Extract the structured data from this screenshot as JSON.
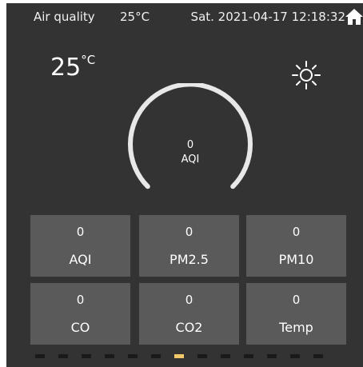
{
  "status_bar": {
    "title": "Air quality",
    "temperature": "25°C",
    "datetime": "Sat. 2021-04-17 12:18:32",
    "home_icon": "home-icon"
  },
  "weather": {
    "temperature_value": "25",
    "temperature_unit": "°C",
    "icon": "sun-icon"
  },
  "gauge": {
    "value": "0",
    "label": "AQI",
    "color": "#e8e8e8"
  },
  "tiles": [
    {
      "value": "0",
      "label": "AQI"
    },
    {
      "value": "0",
      "label": "PM2.5"
    },
    {
      "value": "0",
      "label": "PM10"
    },
    {
      "value": "0",
      "label": "CO"
    },
    {
      "value": "0",
      "label": "CO2"
    },
    {
      "value": "0",
      "label": "Temp"
    }
  ],
  "pager": {
    "page_count": 13,
    "active_page": 6,
    "active_color": "#f2c86a",
    "inactive_color": "#1a1a1a"
  },
  "colors": {
    "background": "#333333",
    "tile": "#5a5a5a",
    "text": "#ffffff"
  }
}
